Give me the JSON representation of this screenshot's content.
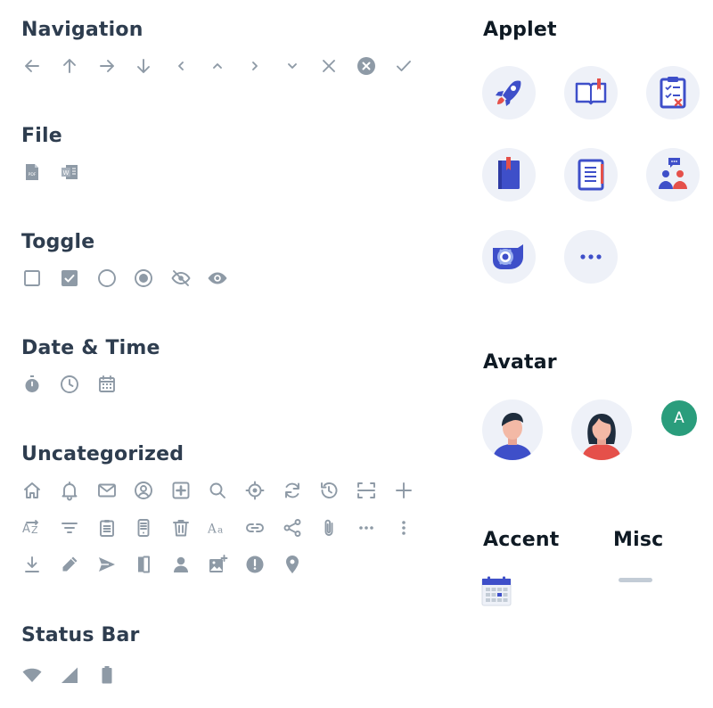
{
  "sections": {
    "navigation": "Navigation",
    "file": "File",
    "toggle": "Toggle",
    "date_time": "Date & Time",
    "uncategorized": "Uncategorized",
    "status_bar": "Status Bar",
    "applet": "Applet",
    "avatar": "Avatar",
    "accent": "Accent",
    "misc": "Misc"
  },
  "icons": {
    "navigation": [
      "arrow-left-icon",
      "arrow-up-icon",
      "arrow-right-icon",
      "arrow-down-icon",
      "chevron-left-icon",
      "chevron-up-icon",
      "chevron-right-icon",
      "chevron-down-icon",
      "close-icon",
      "close-circle-icon",
      "check-icon"
    ],
    "file": [
      "pdf-file-icon",
      "word-file-icon"
    ],
    "toggle": [
      "checkbox-empty-icon",
      "checkbox-checked-icon",
      "radio-empty-icon",
      "radio-selected-icon",
      "eye-off-icon",
      "eye-icon"
    ],
    "date_time": [
      "stopwatch-icon",
      "clock-icon",
      "calendar-icon"
    ],
    "uncategorized": [
      "home-icon",
      "bell-icon",
      "mail-icon",
      "user-circle-icon",
      "plus-square-icon",
      "search-icon",
      "locate-icon",
      "refresh-icon",
      "history-icon",
      "scan-icon",
      "plus-icon",
      "sort-az-icon",
      "filter-icon",
      "clipboard-icon",
      "phone-icon",
      "trash-icon",
      "font-icon",
      "link-icon",
      "share-icon",
      "attachment-icon",
      "more-horizontal-icon",
      "more-vertical-icon",
      "download-icon",
      "pencil-icon",
      "send-icon",
      "door-icon",
      "person-icon",
      "add-image-icon",
      "alert-icon",
      "location-pin-icon"
    ],
    "status_bar": [
      "wifi-icon",
      "signal-icon",
      "battery-icon"
    ],
    "applet": [
      "rocket-icon",
      "book-icon",
      "checklist-icon",
      "notebook-icon",
      "document-icon",
      "team-chat-icon",
      "gear-folder-icon",
      "more-icon"
    ],
    "avatar": [
      "male-avatar",
      "female-avatar"
    ],
    "accent": [
      "calendar-accent-icon"
    ]
  },
  "avatar_letter": "A",
  "colors": {
    "heading": "#2e3d4f",
    "icon_gray": "#8e9aa6",
    "applet_bg": "#eef1f8",
    "applet_blue": "#3e4fc9",
    "applet_red": "#e5504a",
    "letter_avatar": "#2a9d7c"
  }
}
